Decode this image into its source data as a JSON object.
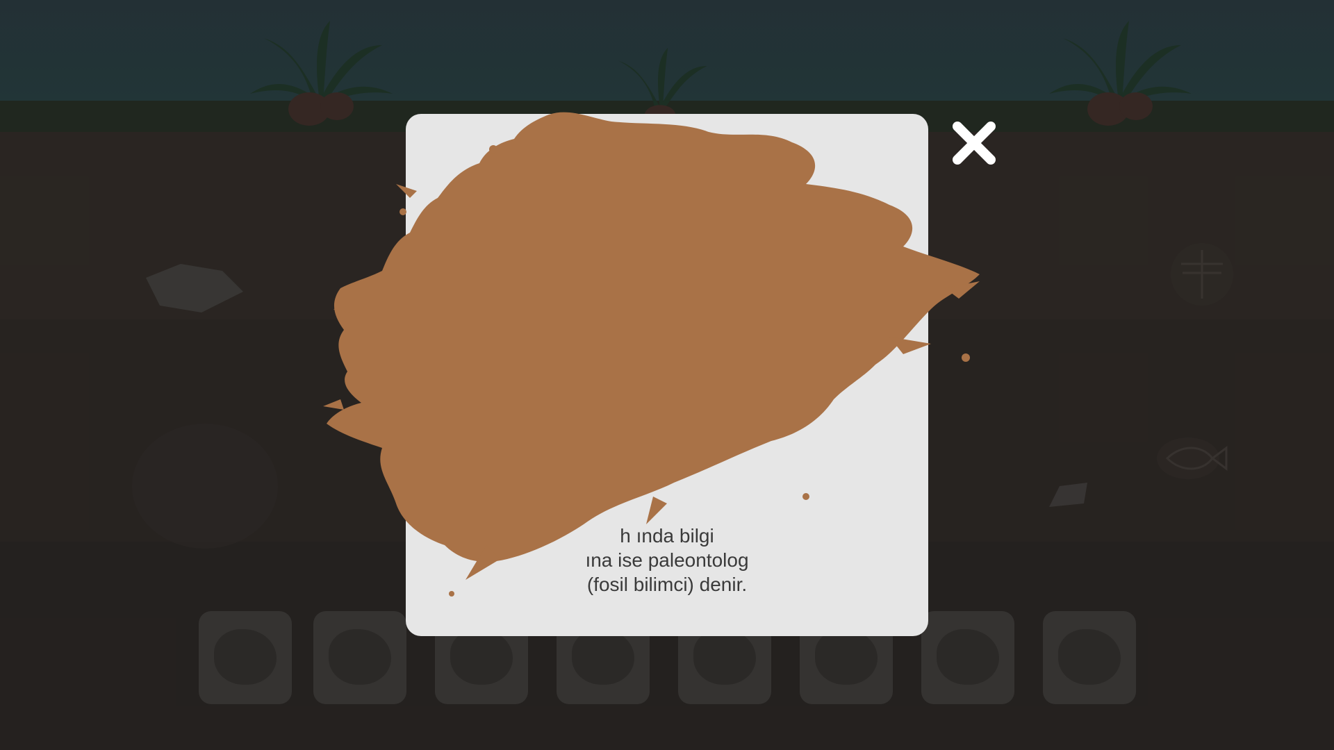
{
  "scene": {
    "sky_color": "#26353a",
    "soil_color": "#2e2925",
    "mud_color": "#a97247"
  },
  "modal": {
    "visible_text": "h… …ında bilgi … …ına ise paleontolog (fosil bilimci) denir.",
    "text_lines": [
      "h                                            ında bilgi",
      "                                          ına ise paleontolog",
      "(fosil bilimci) denir."
    ]
  },
  "close_button": {
    "icon": "close-icon"
  },
  "tray": {
    "slots": [
      {
        "icon": "fern-fossil-icon"
      },
      {
        "icon": "ammonite-fossil-icon"
      },
      {
        "icon": "shell-fossil-icon"
      },
      {
        "icon": "dino-skull-fossil-icon"
      },
      {
        "icon": "bone-fossil-icon"
      },
      {
        "icon": "fish-fossil-icon"
      },
      {
        "icon": "dragonfly-fossil-icon"
      },
      {
        "icon": "trilobite-fossil-icon"
      }
    ]
  }
}
